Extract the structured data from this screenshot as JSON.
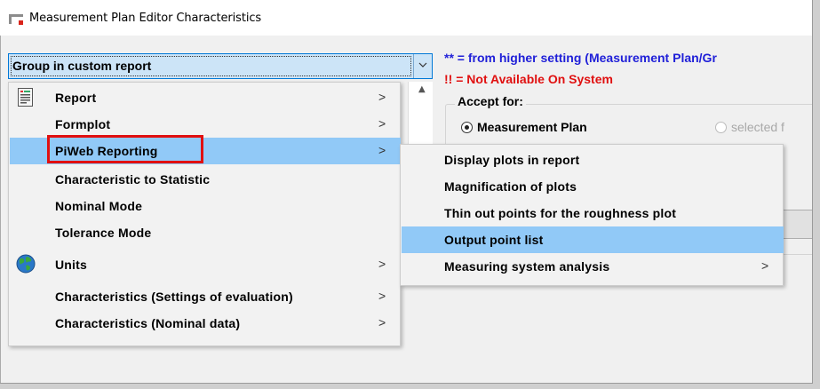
{
  "window": {
    "title": "Measurement Plan Editor Characteristics"
  },
  "combo": {
    "value": "Group in custom report"
  },
  "info": {
    "inherited_note": "** = from higher setting (Measurement Plan/Gr",
    "not_available_note": "!! = Not Available On System"
  },
  "accept_group": {
    "label": "Accept for:",
    "option_measurement_plan": "Measurement Plan",
    "option_selected": "selected f"
  },
  "menu": {
    "items": [
      {
        "label": "Report",
        "icon": "report-icon",
        "has_submenu": true
      },
      {
        "label": "Formplot",
        "has_submenu": true
      },
      {
        "label": "PiWeb Reporting",
        "has_submenu": true,
        "highlighted": true
      },
      {
        "label": "Characteristic to Statistic",
        "has_submenu": false
      },
      {
        "label": "Nominal Mode",
        "has_submenu": false
      },
      {
        "label": "Tolerance Mode",
        "has_submenu": false
      },
      {
        "label": "Units",
        "icon": "globe-icon",
        "has_submenu": true
      },
      {
        "label": "Characteristics (Settings of evaluation)",
        "has_submenu": true
      },
      {
        "label": "Characteristics (Nominal data)",
        "has_submenu": true
      }
    ],
    "arrow": ">"
  },
  "submenu": {
    "items": [
      {
        "label": "Display plots in report",
        "has_submenu": false
      },
      {
        "label": "Magnification of plots",
        "has_submenu": false
      },
      {
        "label": "Thin out points for the roughness plot",
        "has_submenu": false
      },
      {
        "label": "Output point list",
        "has_submenu": false,
        "highlighted": true
      },
      {
        "label": "Measuring system analysis",
        "has_submenu": true
      }
    ]
  },
  "colors": {
    "highlight": "#91c9f7",
    "callout_border": "#e11010",
    "info_blue": "#1f1fd8",
    "info_red": "#e01010",
    "combo_bg": "#cce4f7"
  }
}
